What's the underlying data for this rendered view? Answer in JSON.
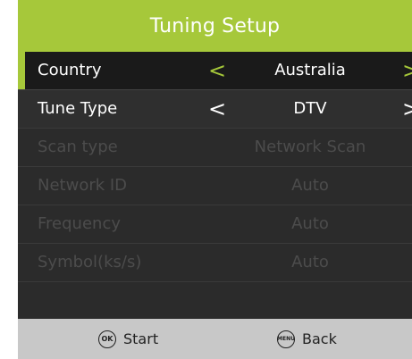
{
  "title": "Tuning Setup",
  "rows": [
    {
      "label": "Country",
      "value": "Australia",
      "left_arrow": "<",
      "right_arrow": ">"
    },
    {
      "label": "Tune Type",
      "value": "DTV",
      "left_arrow": "<",
      "right_arrow": ">"
    },
    {
      "label": "Scan type",
      "value": "Network Scan"
    },
    {
      "label": "Network ID",
      "value": "Auto"
    },
    {
      "label": "Frequency",
      "value": "Auto"
    },
    {
      "label": "Symbol(ks/s)",
      "value": "Auto"
    }
  ],
  "footer": {
    "ok_icon_text": "OK",
    "ok_label": "Start",
    "menu_icon_text": "MENU",
    "menu_label": "Back"
  },
  "colors": {
    "accent": "#a6c83a",
    "background": "#2b2b2b",
    "footer": "#c8c8c8",
    "disabled_text": "#4c4c4c"
  }
}
